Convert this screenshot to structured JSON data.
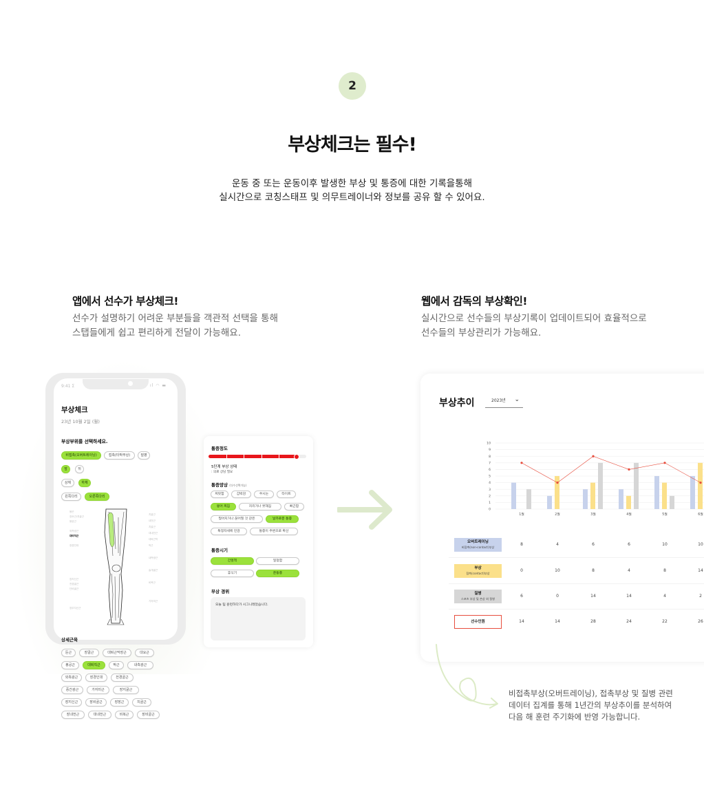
{
  "header": {
    "step": "2",
    "title": "부상체크는 필수!",
    "desc": [
      "운동 중 또는 운동이후 발생한 부상 및 통증에 대한 기록을통해",
      "실시간으로 코칭스태프 및 의무트레이너와 정보를 공유 할 수 있어요."
    ]
  },
  "left": {
    "title": "앱에서 선수가 부상체크!",
    "desc": [
      "선수가 설명하기 어려운 부분들을 객관적 선택을 통해",
      "스탭들에게 쉽고 편리하게 전달이 가능해요."
    ]
  },
  "right": {
    "title": "웹에서 감독의 부상확인!",
    "desc": [
      "실시간으로 선수들의 부상기록이 업데이트되어 효율적으로",
      "선수들의 부상관리가 가능해요."
    ]
  },
  "phone": {
    "status_time": "9:41 Σ",
    "title": "부상체크",
    "date": "23년 10월 2일 (월)",
    "question": "부상부위를 선택하세요.",
    "type_chips": [
      {
        "t": "비접촉(오버트레이닝)",
        "on": true
      },
      {
        "t": "접촉(타박부상)",
        "on": false
      },
      {
        "t": "질병",
        "on": false
      }
    ],
    "fb_chips": [
      {
        "t": "앞",
        "on": true
      },
      {
        "t": "뒤",
        "on": false
      }
    ],
    "ud_chips": [
      {
        "t": "상체",
        "on": false
      },
      {
        "t": "하체",
        "on": true
      }
    ],
    "side_chips": [
      {
        "t": "왼쪽다리",
        "on": false
      },
      {
        "t": "오른쪽다리",
        "on": true
      }
    ],
    "muscle_left": [
      "봉곤",
      "장요근/치골근",
      "봉공근",
      "",
      "외측광근",
      "대퇴직근",
      "",
      "장경인대",
      "",
      "",
      "",
      "",
      "",
      "",
      "장지신근",
      "전경골근",
      "단비골근",
      "",
      "",
      "",
      "장무지신근"
    ],
    "muscle_right": [
      "치골근",
      "내전근",
      "치골근",
      "대내전근",
      "대퇴근막",
      "박근",
      "",
      "내측광근",
      "",
      "슬개골근",
      "",
      "비복근",
      "",
      "",
      "가자미근"
    ],
    "detail_title": "상세근육",
    "detail_rows": [
      [
        {
          "t": "둔근",
          "on": false
        },
        {
          "t": "장골근",
          "on": false
        },
        {
          "t": "대퇴근막장근",
          "on": false
        },
        {
          "t": "대요근",
          "on": false
        }
      ],
      [
        {
          "t": "봉공근",
          "on": false
        },
        {
          "t": "대퇴직근",
          "on": true
        },
        {
          "t": "박근",
          "on": false
        },
        {
          "t": "내측광근",
          "on": false
        }
      ],
      [
        {
          "t": "외측광근",
          "on": false
        },
        {
          "t": "장경인대",
          "on": false
        },
        {
          "t": "전경골근",
          "on": false
        }
      ],
      [
        {
          "t": "중간광근",
          "on": false
        },
        {
          "t": "가자미근",
          "on": false
        },
        {
          "t": "장지굴근",
          "on": false
        }
      ],
      [
        {
          "t": "장지신근",
          "on": false
        },
        {
          "t": "장비골근",
          "on": false
        },
        {
          "t": "장장근",
          "on": false
        },
        {
          "t": "치골근",
          "on": false
        }
      ],
      [
        {
          "t": "장내전근",
          "on": false
        },
        {
          "t": "대내전근",
          "on": false
        },
        {
          "t": "비복근",
          "on": false
        },
        {
          "t": "장비골근",
          "on": false
        }
      ]
    ]
  },
  "card2": {
    "pain_title": "통증정도",
    "pain_level": 0.9,
    "level_text": "5단계 부상 상태",
    "level_sub": ": 의료 상담 필요",
    "type_title": "통증양상",
    "type_hint": "(다수선택가능)",
    "type_chips": [
      [
        {
          "t": "찌릿함",
          "on": false
        },
        {
          "t": "갑박감",
          "on": false
        },
        {
          "t": "쑤시는",
          "on": false
        },
        {
          "t": "타이트",
          "on": false
        }
      ],
      [
        {
          "t": "뭉어 찌짐",
          "on": true
        },
        {
          "t": "지리거나 뭇해짐",
          "on": false
        },
        {
          "t": "뻐근함",
          "on": false
        }
      ],
      [
        {
          "t": "찢어지거나 끊어질 것 같은",
          "on": false
        },
        {
          "t": "날카로운 통증",
          "on": true
        }
      ],
      [
        {
          "t": "특정자세에 민감",
          "on": false
        },
        {
          "t": "통증이 주변으로 확산",
          "on": false
        }
      ]
    ],
    "time_title": "통증시기",
    "time_chips": [
      {
        "t": "간헐적",
        "on": true
      },
      {
        "t": "일정함",
        "on": false
      },
      {
        "t": "휴식기",
        "on": false
      },
      {
        "t": "운동중",
        "on": true
      }
    ],
    "history_title": "부상 경위",
    "history_text": "오늘 팀 훈련하다가 시그니레었습니다."
  },
  "web": {
    "title": "부상추이",
    "year": "2023년",
    "table_labels": [
      {
        "name": "오버트레이닝",
        "sub": "비접촉(non-contact)부상",
        "color": "#c7d2ec"
      },
      {
        "name": "부상",
        "sub": "접촉(contact)부상",
        "color": "#fbe08a"
      },
      {
        "name": "질병",
        "sub": "스포츠 부상 및 손상 외 질병",
        "color": "#d6d6d6"
      },
      {
        "name": "선수인원",
        "sub": "",
        "color": "#ffffff"
      }
    ],
    "table_values": [
      [
        "8",
        "4",
        "6",
        "6",
        "10",
        "10"
      ],
      [
        "0",
        "10",
        "8",
        "4",
        "8",
        "14"
      ],
      [
        "6",
        "0",
        "14",
        "14",
        "4",
        "2"
      ],
      [
        "14",
        "14",
        "28",
        "24",
        "22",
        "26"
      ]
    ]
  },
  "chart_data": {
    "type": "bar",
    "categories": [
      "1월",
      "2월",
      "3월",
      "4월",
      "5월",
      "6월"
    ],
    "yticks": [
      "0",
      "1",
      "2",
      "3",
      "4",
      "5",
      "6",
      "7",
      "8",
      "9",
      "10"
    ],
    "ylim": [
      0,
      10
    ],
    "series": [
      {
        "values": [
          4,
          2,
          3,
          3,
          5,
          5
        ],
        "color": "#c7d2ec"
      },
      {
        "values": [
          0,
          5,
          4,
          2,
          4,
          7
        ],
        "color": "#fbe08a"
      },
      {
        "values": [
          3,
          0,
          7,
          7,
          2,
          1
        ],
        "color": "#d6d6d6"
      }
    ],
    "line": {
      "values": [
        7,
        4,
        8,
        6,
        7,
        4
      ],
      "color": "#e74c3c"
    }
  },
  "note": {
    "lines": [
      "비접촉부상(오버트레이닝), 접촉부상 및 질병 관련",
      "데이터 집계를 통해 1년간의 부상추이를 분석하여",
      "다음 해 훈련 주기화에 반영 가능합니다."
    ]
  }
}
